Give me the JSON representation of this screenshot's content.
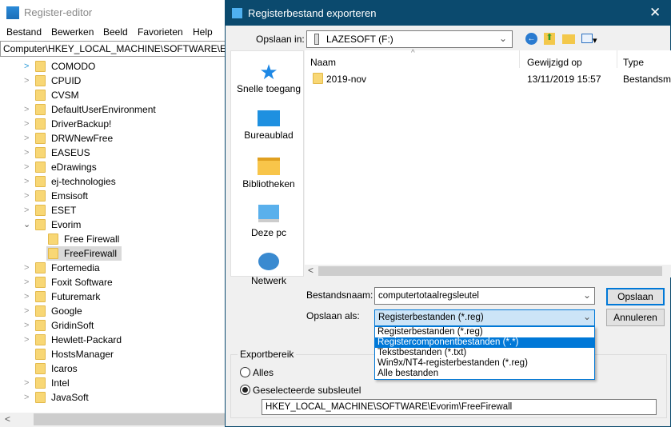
{
  "regedit": {
    "title": "Register-editor",
    "menu": [
      "Bestand",
      "Bewerken",
      "Beeld",
      "Favorieten",
      "Help"
    ],
    "address": "Computer\\HKEY_LOCAL_MACHINE\\SOFTWARE\\Evorim",
    "tree": [
      {
        "label": "COMODO",
        "level": 0,
        "exp": "blue"
      },
      {
        "label": "CPUID",
        "level": 0,
        "exp": "y"
      },
      {
        "label": "CVSM",
        "level": 0,
        "exp": "n"
      },
      {
        "label": "DefaultUserEnvironment",
        "level": 0,
        "exp": "y"
      },
      {
        "label": "DriverBackup!",
        "level": 0,
        "exp": "y"
      },
      {
        "label": "DRWNewFree",
        "level": 0,
        "exp": "y"
      },
      {
        "label": "EASEUS",
        "level": 0,
        "exp": "y"
      },
      {
        "label": "eDrawings",
        "level": 0,
        "exp": "y"
      },
      {
        "label": "ej-technologies",
        "level": 0,
        "exp": "y"
      },
      {
        "label": "Emsisoft",
        "level": 0,
        "exp": "y"
      },
      {
        "label": "ESET",
        "level": 0,
        "exp": "y"
      },
      {
        "label": "Evorim",
        "level": 0,
        "exp": "open"
      },
      {
        "label": "Free Firewall",
        "level": 1,
        "exp": "n"
      },
      {
        "label": "FreeFirewall",
        "level": 1,
        "exp": "n",
        "selected": true
      },
      {
        "label": "Fortemedia",
        "level": 0,
        "exp": "y"
      },
      {
        "label": "Foxit Software",
        "level": 0,
        "exp": "y"
      },
      {
        "label": "Futuremark",
        "level": 0,
        "exp": "y"
      },
      {
        "label": "Google",
        "level": 0,
        "exp": "y"
      },
      {
        "label": "GridinSoft",
        "level": 0,
        "exp": "y"
      },
      {
        "label": "Hewlett-Packard",
        "level": 0,
        "exp": "y"
      },
      {
        "label": "HostsManager",
        "level": 0,
        "exp": "n"
      },
      {
        "label": "Icaros",
        "level": 0,
        "exp": "n"
      },
      {
        "label": "Intel",
        "level": 0,
        "exp": "y"
      },
      {
        "label": "JavaSoft",
        "level": 0,
        "exp": "y"
      }
    ]
  },
  "dialog": {
    "title": "Registerbestand exporteren",
    "save_in_label": "Opslaan in:",
    "save_in_value": "LAZESOFT (F:)",
    "places": [
      "Snelle toegang",
      "Bureaublad",
      "Bibliotheken",
      "Deze pc",
      "Netwerk"
    ],
    "columns": [
      "Naam",
      "Gewijzigd op",
      "Type"
    ],
    "files": [
      {
        "name": "2019-nov",
        "modified": "13/11/2019 15:57",
        "type": "Bestandsm"
      }
    ],
    "filename_label": "Bestandsnaam:",
    "filename_value": "computertotaalregsleutel",
    "savetype_label": "Opslaan als:",
    "savetype_value": "Registerbestanden (*.reg)",
    "savetype_options": [
      "Registerbestanden (*.reg)",
      "Registercomponentbestanden (*.*)",
      "Tekstbestanden (*.txt)",
      "Win9x/NT4-registerbestanden (*.reg)",
      "Alle bestanden"
    ],
    "highlighted_option": 1,
    "save_button": "Opslaan",
    "cancel_button": "Annuleren",
    "export_range_label": "Exportbereik",
    "radio_all": "Alles",
    "radio_selected": "Geselecteerde subsleutel",
    "selected_radio": "selected",
    "branch_value": "HKEY_LOCAL_MACHINE\\SOFTWARE\\Evorim\\FreeFirewall"
  },
  "colors": {
    "titlebar": "#0b4a6e",
    "highlight": "#0078d7",
    "accent": "#0078d7"
  }
}
